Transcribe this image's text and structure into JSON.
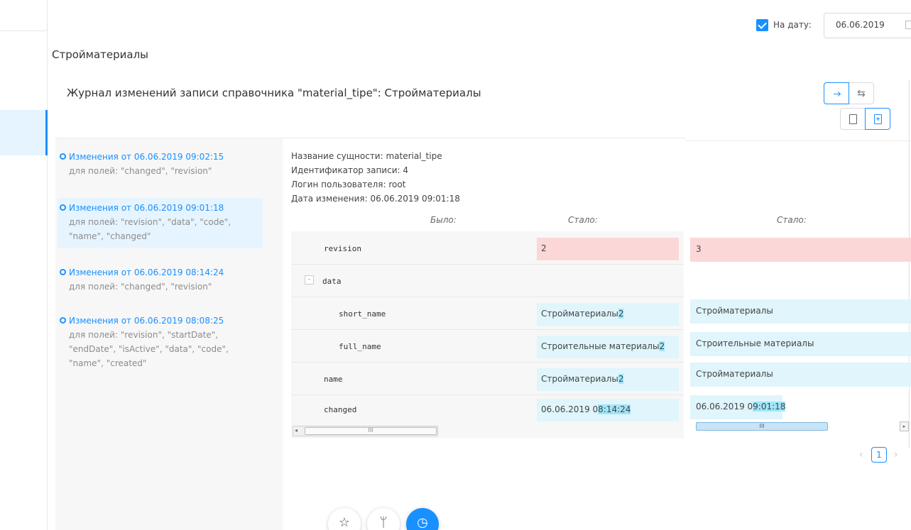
{
  "header": {
    "date_filter_checked": true,
    "date_filter_label": "На дату:",
    "date_value": "06.06.2019",
    "page_title": "Стройматериалы",
    "journal_title": "Журнал изменений записи справочника \"material_tipe\": Стройматериалы"
  },
  "history": [
    {
      "title": "Изменения от 06.06.2019 09:02:15",
      "fields": "для полей: \"changed\", \"revision\""
    },
    {
      "title": "Изменения от 06.06.2019 09:01:18",
      "fields": "для полей: \"revision\", \"data\", \"code\", \"name\", \"changed\""
    },
    {
      "title": "Изменения от 06.06.2019 08:14:24",
      "fields": "для полей: \"changed\", \"revision\""
    },
    {
      "title": "Изменения от 06.06.2019 08:08:25",
      "fields": "для полей: \"revision\", \"startDate\", \"endDate\", \"isActive\", \"data\", \"code\", \"name\", \"created\""
    }
  ],
  "info": {
    "entity": "Название сущности: material_tipe",
    "record_id": "Идентификатор записи: 4",
    "login": "Логин пользователя: root",
    "change_date": "Дата изменения: 06.06.2019 09:01:18"
  },
  "columns": {
    "was": "Было:",
    "became": "Стало:",
    "became2": "Стало:"
  },
  "diff": {
    "revision": {
      "name": "revision",
      "old": "2",
      "new": "3"
    },
    "data": {
      "name": "data",
      "collapse_label": "-"
    },
    "short_name": {
      "name": "short_name",
      "old": "Стройматериалы",
      "old_suffix": "2",
      "new": "Стройматериалы"
    },
    "full_name": {
      "name": "full_name",
      "old": "Строительные материалы",
      "old_suffix": "2",
      "new": "Строительные материалы"
    },
    "name": {
      "name": "name",
      "old": "Стройматериалы",
      "old_suffix": "2",
      "new": "Стройматериалы"
    },
    "changed": {
      "name": "changed",
      "old_prefix": "06.06.2019 0",
      "old_hl": "8:14:24",
      "new_prefix": "06.06.2019 0",
      "new_hl": "9:01:18"
    }
  },
  "scroll_thumb": "III",
  "pagination": {
    "current": "1"
  },
  "icons": {
    "view_arrow": "arrow-right-icon",
    "view_swap": "swap-icon",
    "file": "file-icon",
    "file_add": "file-add-icon",
    "fab1": "star-icon",
    "fab2": "branch-icon",
    "fab3": "clock-icon"
  },
  "colors": {
    "accent": "#1890ff",
    "added": "#e0f5fc",
    "changed_bg": "#fcd7d7",
    "highlight": "#9fe6fa"
  }
}
